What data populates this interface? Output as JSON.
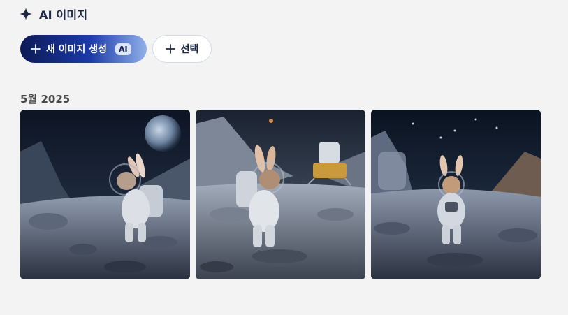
{
  "header": {
    "icon": "sparkle-icon",
    "title": "AI 이미지"
  },
  "toolbar": {
    "new_image_label": "새 이미지 생성",
    "new_image_badge": "AI",
    "select_label": "선택"
  },
  "section": {
    "label": "5월 2025"
  },
  "images": [
    {
      "name": "rabbit-astronaut-earth"
    },
    {
      "name": "rabbit-astronaut-lander"
    },
    {
      "name": "rabbit-astronaut-front"
    }
  ],
  "colors": {
    "accent_dark": "#0c1a55",
    "accent_mid": "#1c3aa8",
    "accent_light": "#90b0ea",
    "background": "#f3f3f3"
  }
}
